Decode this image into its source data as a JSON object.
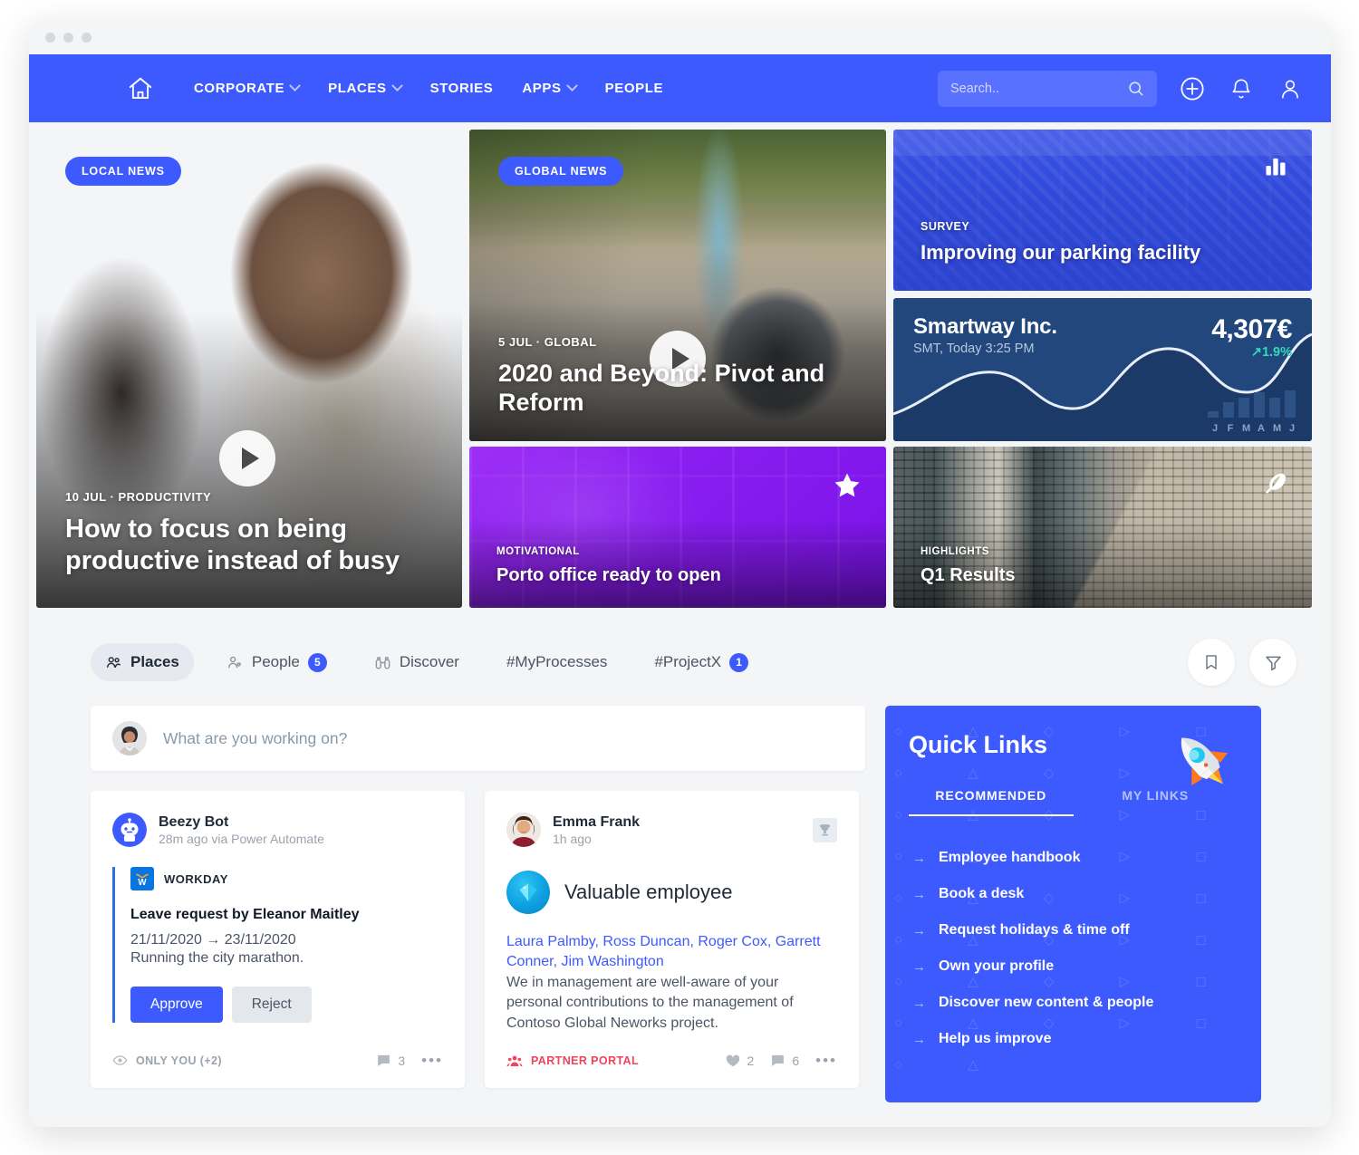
{
  "window": {
    "dots": 3
  },
  "nav": {
    "home_icon": "home-icon",
    "links": [
      {
        "label": "CORPORATE",
        "has_chevron": true
      },
      {
        "label": "PLACES",
        "has_chevron": true
      },
      {
        "label": "STORIES",
        "has_chevron": false
      },
      {
        "label": "APPS",
        "has_chevron": true
      },
      {
        "label": "PEOPLE",
        "has_chevron": false
      }
    ],
    "search": {
      "placeholder": "Search..",
      "value": ""
    },
    "icons": [
      "add-icon",
      "bell-icon",
      "user-icon"
    ]
  },
  "hero": {
    "main": {
      "badge": "LOCAL NEWS",
      "kicker": "10 JUL · PRODUCTIVITY",
      "headline": "How to focus on being productive instead of busy",
      "has_play": true
    },
    "global": {
      "badge": "GLOBAL NEWS",
      "kicker": "5 JUL · GLOBAL",
      "headline": "2020 and Beyond: Pivot and Reform",
      "has_play": true
    },
    "survey": {
      "kicker": "SURVEY",
      "headline": "Improving our parking facility",
      "icon": "bar-chart-icon"
    },
    "stock": {
      "name": "Smartway Inc.",
      "subtitle": "SMT, Today 3:25 PM",
      "price": "4,307€",
      "change": "↗1.9%"
    },
    "motivational": {
      "kicker": "MOTIVATIONAL",
      "headline": "Porto office ready to open",
      "icon": "star-icon"
    },
    "highlights": {
      "kicker": "HIGHLIGHTS",
      "headline": "Q1 Results",
      "icon": "feather-icon"
    }
  },
  "chart_data": {
    "type": "bar",
    "title": "Smartway Inc.",
    "categories": [
      "J",
      "F",
      "M",
      "A",
      "M",
      "J"
    ],
    "values": [
      4,
      10,
      13,
      17,
      13,
      18
    ],
    "xlabel": "",
    "ylabel": "",
    "ylim": [
      0,
      20
    ],
    "grid": false,
    "legend": "none",
    "annotations": [
      "4,307€",
      "↗1.9%",
      "SMT, Today 3:25 PM"
    ]
  },
  "tabs": {
    "items": [
      {
        "label": "Places",
        "icon": "people-group-icon",
        "count": "",
        "active": true
      },
      {
        "label": "People",
        "icon": "person-heart-icon",
        "count": "5",
        "active": false
      },
      {
        "label": "Discover",
        "icon": "binoculars-icon",
        "count": "",
        "active": false
      },
      {
        "label": "#MyProcesses",
        "icon": "",
        "count": "",
        "active": false
      },
      {
        "label": "#ProjectX",
        "icon": "",
        "count": "1",
        "active": false
      }
    ],
    "actions": [
      "bookmark-icon",
      "filter-icon"
    ]
  },
  "composer": {
    "placeholder": "What are you working on?",
    "value": ""
  },
  "posts": [
    {
      "author": "Beezy Bot",
      "meta": "28m ago via Power Automate",
      "app_name": "WORKDAY",
      "title": "Leave request by Eleanor Maitley",
      "dates": "21/11/2020 → 23/11/2020",
      "note": "Running the city marathon.",
      "approve_label": "Approve",
      "reject_label": "Reject",
      "visibility": "ONLY YOU (+2)",
      "comments": "3",
      "more": "•••"
    },
    {
      "author": "Emma Frank",
      "meta": "1h ago",
      "badge_name": "Valuable employee",
      "mentions": "Laura Palmby, Ross Duncan, Roger Cox, Garrett Conner, Jim Washington",
      "body": "We in management are well-aware of your personal contributions to the management of Contoso Global Neworks project.",
      "space": "PARTNER PORTAL",
      "likes": "2",
      "comments": "6",
      "more": "•••"
    }
  ],
  "quick_links": {
    "title": "Quick Links",
    "tabs": [
      {
        "label": "RECOMMENDED",
        "active": true
      },
      {
        "label": "MY LINKS",
        "active": false
      }
    ],
    "links": [
      "Employee handbook",
      "Book a desk",
      "Request holidays & time off",
      "Own your profile",
      "Discover new content & people",
      "Help us improve"
    ],
    "icon": "rocket-icon"
  },
  "colors": {
    "brand_blue": "#3d5afe",
    "stock_navy": "#22477c",
    "stock_green": "#2fd9b9",
    "motivational_purple": "#8a1ef0",
    "partner_red": "#f1435e",
    "page_bg": "#f4f5f7"
  }
}
